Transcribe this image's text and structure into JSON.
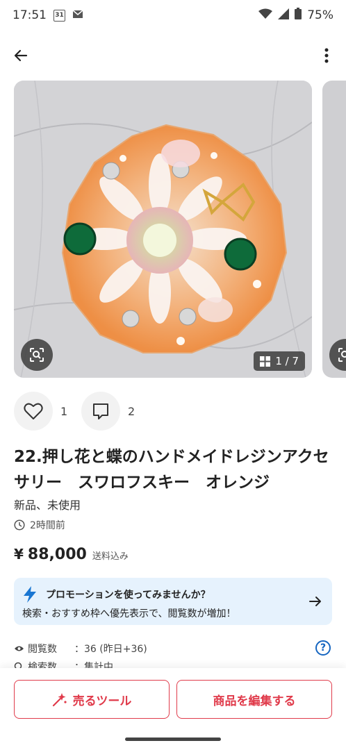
{
  "status_bar": {
    "time": "17:51",
    "calendar_day": "31",
    "battery": "75%"
  },
  "product": {
    "image_counter": "1 / 7",
    "likes": "1",
    "comments": "2",
    "title": "22.押し花と蝶のハンドメイドレジンアクセサリー　スワロフスキー　オレンジ",
    "condition": "新品、未使用",
    "posted_time": "2時間前",
    "price_symbol": "¥",
    "price": "88,000",
    "shipping": "送料込み"
  },
  "promo": {
    "line1": "プロモーションを使ってみませんか？",
    "line2": "検索・おすすめ枠へ優先表示で、閲覧数が増加！"
  },
  "stats": {
    "views_label": "閲覧数",
    "views_value": "：36 (昨日+36)",
    "search_label": "検索数",
    "search_value": "：集計中"
  },
  "bottom": {
    "sell_tool_label": "売るツール",
    "edit_label": "商品を編集する"
  },
  "colors": {
    "accent": "#e03a4a",
    "promo_bg": "#e6f2fd",
    "promo_icon": "#1976d2"
  }
}
